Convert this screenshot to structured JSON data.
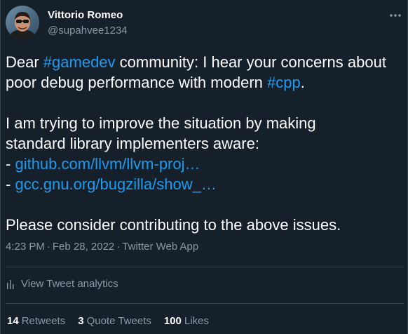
{
  "author": {
    "name": "Vittorio Romeo",
    "handle": "@supahvee1234"
  },
  "tweet": {
    "line1_pre": "Dear ",
    "line1_hashtag": "#gamedev",
    "line1_post": " community: I hear your concerns about",
    "line2_pre": "poor debug performance with modern ",
    "line2_hashtag": "#cpp",
    "line2_post": ".",
    "line3": "I am trying to improve the situation by making",
    "line4": "standard library implementers aware:",
    "link1_prefix": "- ",
    "link1": "github.com/llvm/llvm-proj…",
    "link2_prefix": "- ",
    "link2": "gcc.gnu.org/bugzilla/show_…",
    "line7": "Please consider contributing to the above issues."
  },
  "meta": {
    "time": "4:23 PM",
    "separator": "·",
    "date": "Feb 28, 2022",
    "source": "Twitter Web App"
  },
  "analytics": {
    "label": "View Tweet analytics"
  },
  "stats": {
    "retweets_count": "14",
    "retweets_label": "Retweets",
    "quotes_count": "3",
    "quotes_label": "Quote Tweets",
    "likes_count": "100",
    "likes_label": "Likes"
  },
  "icons": {
    "more": "more-horizontal-icon",
    "analytics": "bar-chart-icon"
  },
  "colors": {
    "background": "#15202b",
    "accent": "#1d9bf0",
    "secondary_text": "#8b98a5",
    "border": "#38444d"
  }
}
